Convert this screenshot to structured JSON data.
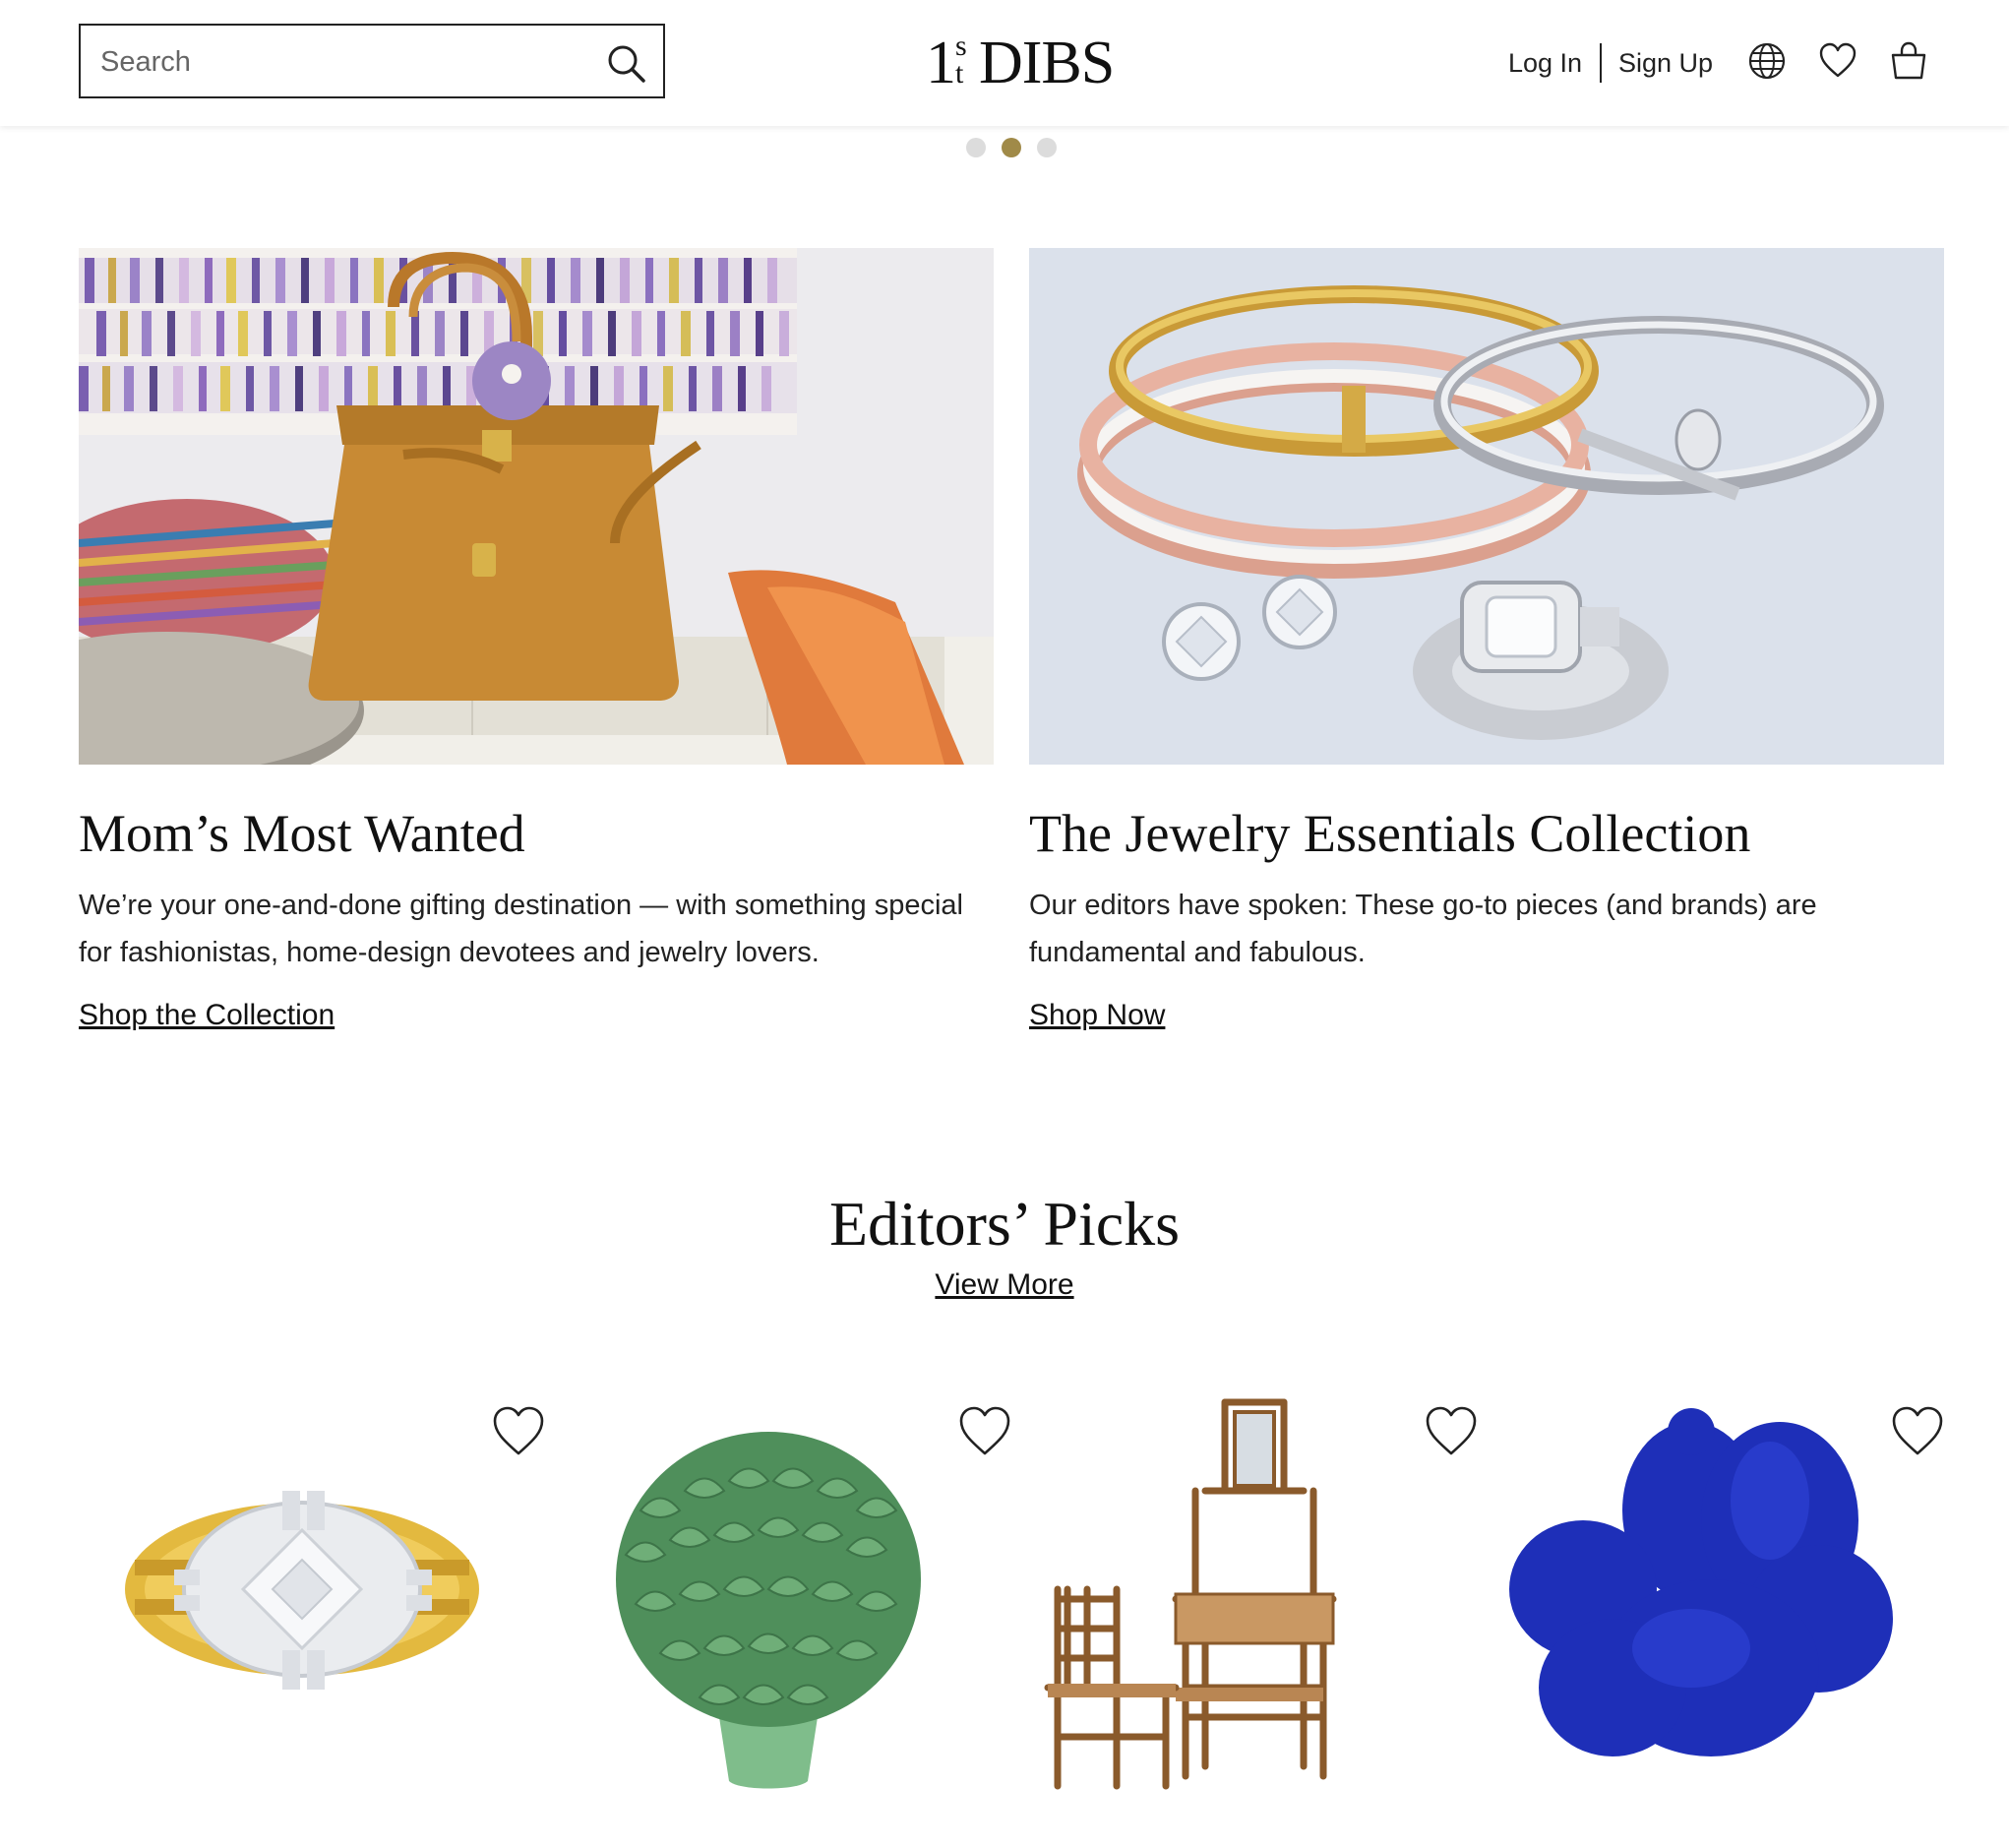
{
  "header": {
    "search_placeholder": "Search",
    "logo": {
      "one": "1",
      "st_s": "s",
      "st_t": "t",
      "dibs": "DIBS"
    },
    "login_label": "Log In",
    "signup_label": "Sign Up",
    "icons": [
      "search-icon",
      "globe-icon",
      "heart-icon",
      "shopping-bag-icon"
    ]
  },
  "carousel": {
    "total_slides": 3,
    "active_slide": 2,
    "active_color": "#a08a48",
    "inactive_color": "#dcdcdc"
  },
  "features": [
    {
      "title": "Mom’s Most Wanted",
      "description": "We’re your one-and-done gifting destination — with something special for fashionistas, home-design devotees and jewelry lovers.",
      "link": "Shop the Collection"
    },
    {
      "title": "The Jewelry Essentials Collection",
      "description": "Our editors have spoken: These go-to pieces (and brands) are fundamental and fabulous.",
      "link": "Shop Now"
    }
  ],
  "editors_picks": {
    "title": "Editors’ Picks",
    "view_more": "View More",
    "products": [
      {
        "name": "gold-crystal-ring"
      },
      {
        "name": "green-ceramic-vase"
      },
      {
        "name": "bamboo-vanity-and-chair"
      },
      {
        "name": "blue-cloud-armchair"
      }
    ]
  }
}
